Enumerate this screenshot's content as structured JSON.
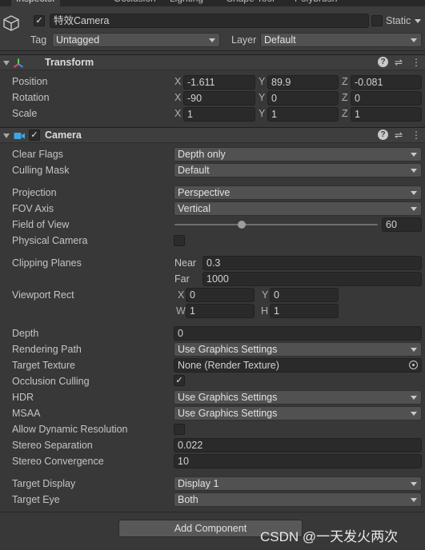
{
  "tabs": [
    "Inspector",
    "Occlusion",
    "Lighting",
    "Shape Tool",
    "Polybrush"
  ],
  "header": {
    "object_active": true,
    "object_name": "特效Camera",
    "static_label": "Static",
    "tag_label": "Tag",
    "tag_value": "Untagged",
    "layer_label": "Layer",
    "layer_value": "Default"
  },
  "transform": {
    "title": "Transform",
    "position_label": "Position",
    "position": {
      "x": "-1.611",
      "y": "89.9",
      "z": "-0.081"
    },
    "rotation_label": "Rotation",
    "rotation": {
      "x": "-90",
      "y": "0",
      "z": "0"
    },
    "scale_label": "Scale",
    "scale": {
      "x": "1",
      "y": "1",
      "z": "1"
    },
    "axis": {
      "x": "X",
      "y": "Y",
      "z": "Z"
    }
  },
  "camera": {
    "title": "Camera",
    "enabled": true,
    "clear_flags_label": "Clear Flags",
    "clear_flags": "Depth only",
    "culling_mask_label": "Culling Mask",
    "culling_mask": "Default",
    "projection_label": "Projection",
    "projection": "Perspective",
    "fov_axis_label": "FOV Axis",
    "fov_axis": "Vertical",
    "fov_label": "Field of View",
    "fov_value": "60",
    "fov_slider_fraction": 0.33,
    "physical_camera_label": "Physical Camera",
    "physical_camera": false,
    "clipping_label": "Clipping Planes",
    "near_label": "Near",
    "near_value": "0.3",
    "far_label": "Far",
    "far_value": "1000",
    "viewport_label": "Viewport Rect",
    "viewport": {
      "x": "0",
      "y": "0",
      "w": "1",
      "h": "1"
    },
    "viewport_axis": {
      "x": "X",
      "y": "Y",
      "w": "W",
      "h": "H"
    },
    "depth_label": "Depth",
    "depth_value": "0",
    "rendering_path_label": "Rendering Path",
    "rendering_path": "Use Graphics Settings",
    "target_texture_label": "Target Texture",
    "target_texture": "None (Render Texture)",
    "occlusion_label": "Occlusion Culling",
    "occlusion": true,
    "hdr_label": "HDR",
    "hdr": "Use Graphics Settings",
    "msaa_label": "MSAA",
    "msaa": "Use Graphics Settings",
    "dynamic_res_label": "Allow Dynamic Resolution",
    "dynamic_res": false,
    "stereo_sep_label": "Stereo Separation",
    "stereo_sep": "0.022",
    "stereo_conv_label": "Stereo Convergence",
    "stereo_conv": "10",
    "target_display_label": "Target Display",
    "target_display": "Display 1",
    "target_eye_label": "Target Eye",
    "target_eye": "Both"
  },
  "add_component_label": "Add Component",
  "watermark": "CSDN @一天发火两次",
  "icons": {
    "check": "✓",
    "help": "?",
    "presets": "⇌",
    "menu": "⋮"
  },
  "colors": {
    "background": "#383838",
    "field": "#2a2a2a",
    "dropdown": "#515151",
    "camera_icon": "#3fa7e0"
  }
}
